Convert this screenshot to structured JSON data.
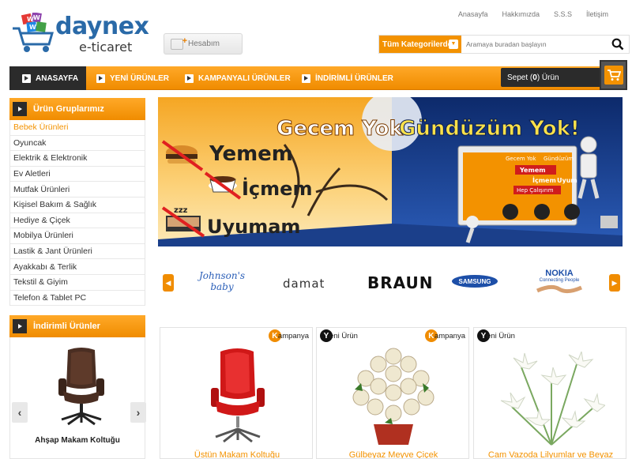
{
  "brand": {
    "name": "daynex",
    "subtitle": "e-ticaret"
  },
  "account": {
    "label": "Hesabım"
  },
  "top_links": [
    "Anasayfa",
    "Hakkımızda",
    "S.S.S",
    "İletişim"
  ],
  "search": {
    "category_label": "Tüm Kategorilerde",
    "placeholder": "Aramaya buradan başlayın"
  },
  "nav": {
    "items": [
      "ANASAYFA",
      "YENİ ÜRÜNLER",
      "KAMPANYALI ÜRÜNLER",
      "İNDİRİMLİ ÜRÜNLER"
    ],
    "cart_prefix": "Sepet (",
    "cart_count": "0",
    "cart_suffix": ") Ürün"
  },
  "sidebar": {
    "title": "Ürün Gruplarımız",
    "categories": [
      "Bebek Ürünleri",
      "Oyuncak",
      "Elektrik & Elektronik",
      "Ev Aletleri",
      "Mutfak Ürünleri",
      "Kişisel Bakım & Sağlık",
      "Hediye & Çiçek",
      "Mobilya Ürünleri",
      "Lastik & Jant Ürünleri",
      "Ayakkabı & Terlik",
      "Tekstil & Giyim",
      "Telefon & Tablet PC"
    ],
    "active_index": 0
  },
  "discounted": {
    "title": "İndirimli Ürünler",
    "product_name": "Ahşap Makam Koltuğu",
    "prev": "‹",
    "next": "›"
  },
  "banner": {
    "headline_left": "Gecem Yok",
    "headline_right": "Gündüzüm Yok!",
    "line1": "Yemem",
    "line2": "İçmem",
    "line3": "Uyumam",
    "screen_text1": "Gecem Yok",
    "screen_text2": "Gündüzüm",
    "screen_yemem": "Yemem",
    "screen_icmem": "İçmem",
    "screen_uyum": "Uyum",
    "screen_hep": "Hep Çalışırım",
    "sleep": "zzz"
  },
  "brands": {
    "johnson": {
      "top": "Johnson's",
      "bottom": "baby"
    },
    "damat": "damat",
    "braun": "BRAUN",
    "samsung": "SAMSUNG",
    "nokia": {
      "top": "NOKIA",
      "bottom": "Connecting People"
    },
    "prev": "◀",
    "next": "▶"
  },
  "products": [
    {
      "badge_right": {
        "letter": "K",
        "rest": "ampanya"
      },
      "badge_left": null,
      "name": "Üstün Makam Koltuğu"
    },
    {
      "badge_left": {
        "letter": "Y",
        "rest": "eni Ürün"
      },
      "badge_right": {
        "letter": "K",
        "rest": "ampanya"
      },
      "name": "Gülbeyaz Meyve Çiçek"
    },
    {
      "badge_left": {
        "letter": "Y",
        "rest": "eni Ürün"
      },
      "badge_right": null,
      "name": "Cam Vazoda Lilyumlar ve Beyaz"
    }
  ],
  "colors": {
    "accent": "#f39200",
    "dark": "#2b2b2b",
    "brand_blue": "#2a6aa8"
  }
}
